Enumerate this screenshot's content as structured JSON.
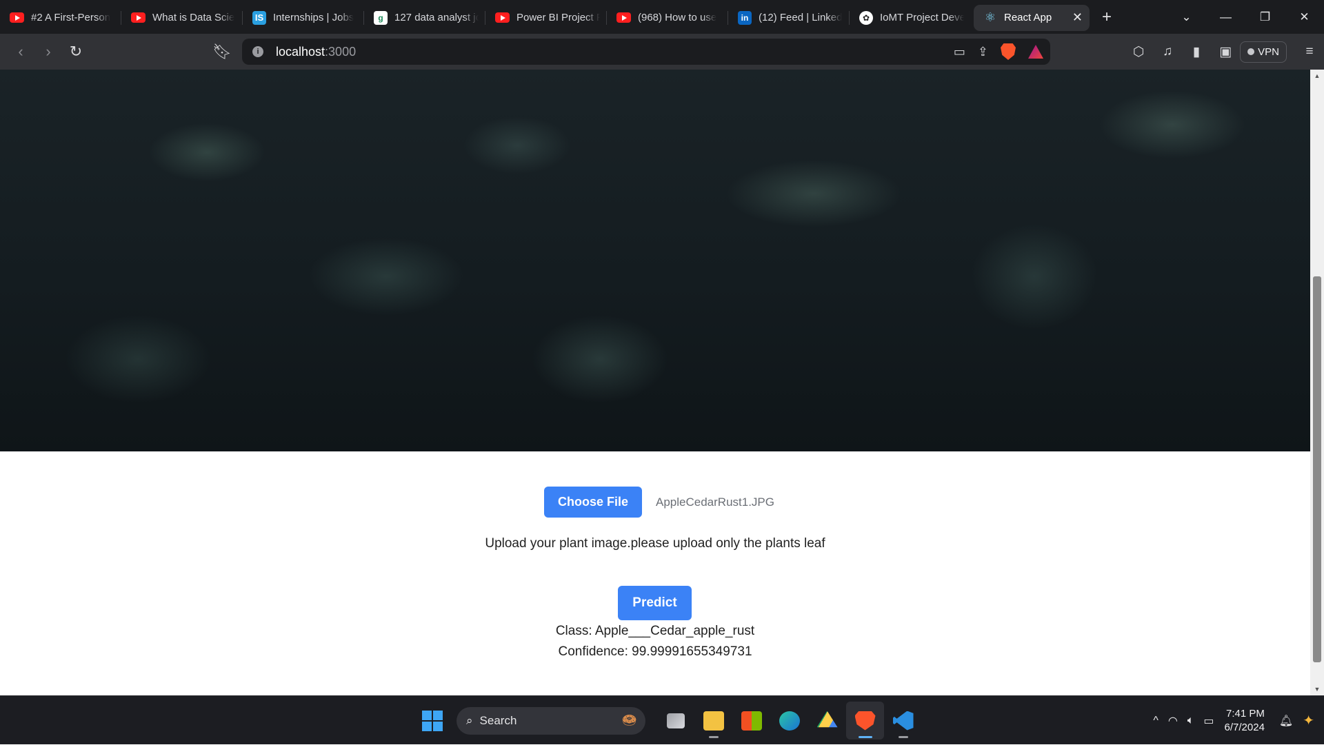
{
  "browser": {
    "tabs": [
      {
        "label": "#2 A First-Person",
        "favicon": "youtube-icon"
      },
      {
        "label": "What is Data Scie",
        "favicon": "youtube-icon"
      },
      {
        "label": "Internships | Jobs",
        "favicon": "internshala-icon"
      },
      {
        "label": "127 data analyst jo",
        "favicon": "glassdoor-icon"
      },
      {
        "label": "Power BI Project F",
        "favicon": "youtube-icon"
      },
      {
        "label": "(968) How to use",
        "favicon": "youtube-icon"
      },
      {
        "label": "(12) Feed | Linked",
        "favicon": "linkedin-icon"
      },
      {
        "label": "IoMT Project Deve",
        "favicon": "chatgpt-icon"
      },
      {
        "label": "React App",
        "favicon": "react-icon",
        "active": true
      }
    ],
    "url_host": "localhost",
    "url_port": ":3000",
    "vpn_label": "VPN",
    "rewards_badge": "1"
  },
  "page": {
    "choose_file_label": "Choose File",
    "file_name": "AppleCedarRust1.JPG",
    "upload_hint": "Upload your plant image.please upload only the plants leaf",
    "predict_label": "Predict",
    "class_text": "Class: Apple___Cedar_apple_rust",
    "confidence_text": "Confidence: 99.99991655349731"
  },
  "taskbar": {
    "search_label": "Search",
    "time": "7:41 PM",
    "date": "6/7/2024"
  },
  "colors": {
    "accent_button": "#3b82f6",
    "tab_bar": "#1b1c1f",
    "toolbar": "#313236"
  }
}
